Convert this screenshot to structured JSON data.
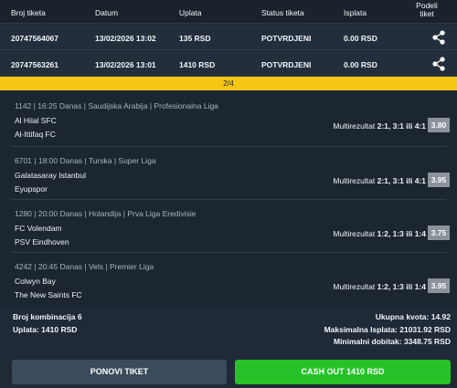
{
  "table": {
    "headers": {
      "ticket": "Broj tiketa",
      "date": "Datum",
      "stake": "Uplata",
      "status": "Status tiketa",
      "payout": "Isplata",
      "share_line1": "Podeli",
      "share_line2": "tiket"
    },
    "rows": [
      {
        "ticket": "20747564067",
        "date": "13/02/2026 13:02",
        "stake": "135 RSD",
        "status": "POTVRDJENI",
        "payout": "0.00 RSD",
        "share_icon": "share-icon"
      },
      {
        "ticket": "20747563261",
        "date": "13/02/2026 13:01",
        "stake": "1410 RSD",
        "status": "POTVRDJENI",
        "payout": "0.00 RSD",
        "share_icon": "share-icon"
      }
    ]
  },
  "pager": {
    "text": "2/4"
  },
  "matches": [
    {
      "info": "1142 | 16:25 Danas | Saudijska Arabija | Profesionalna Liga",
      "home": "Al Hilal SFC",
      "away": "Al-Ittifaq FC",
      "market": "Multirezultat",
      "pick": "2:1, 3:1 ili 4:1",
      "odd": "3.80"
    },
    {
      "info": "6701 | 18:00 Danas | Turska | Super Liga",
      "home": "Galatasaray Istanbul",
      "away": "Eyupspor",
      "market": "Multirezultat",
      "pick": "2:1, 3:1 ili 4:1",
      "odd": "3.95"
    },
    {
      "info": "1280 | 20:00 Danas | Holandija | Prva Liga Eredivisie",
      "home": "FC Volendam",
      "away": "PSV Eindhoven",
      "market": "Multirezultat",
      "pick": "1:2, 1:3 ili 1:4",
      "odd": "3.75"
    },
    {
      "info": "4242 | 20:45 Danas | Vels | Premier Liga",
      "home": "Colwyn Bay",
      "away": "The New Saints FC",
      "market": "Multirezultat",
      "pick": "1:2, 1:3 ili 1:4",
      "odd": "3.95"
    }
  ],
  "summary": {
    "combinations": "Broj kombinacija 6",
    "stake": "Uplata: 1410 RSD",
    "total_odd": "Ukupna kvota: 14.92",
    "max_payout": "Maksimalna Isplata: 21031.92 RSD",
    "min_win": "Minimalni dobitak: 3348.75 RSD"
  },
  "buttons": {
    "repeat": "PONOVI TIKET",
    "cashout": "CASH OUT 1410 RSD"
  },
  "colors": {
    "background": "#1f2a36",
    "pager": "#f4c512",
    "cashout": "#27c22a",
    "repeat": "#3a4b5b",
    "odd_badge": "#8b929a"
  }
}
